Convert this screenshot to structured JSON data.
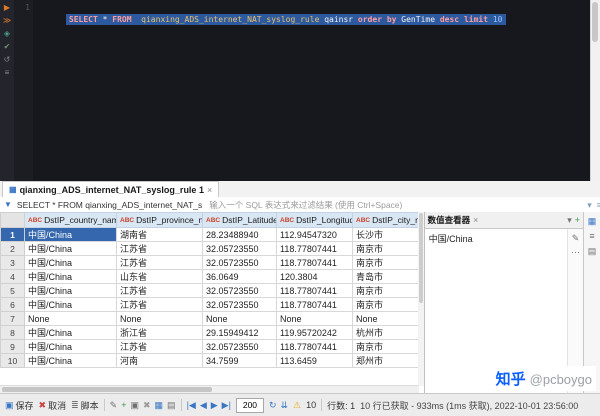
{
  "colors": {
    "selection_blue": "#2d5a9e",
    "accent_blue": "#3a76c4",
    "warning_yellow": "#e6a817",
    "brand_blue": "#0b5fff",
    "header_blue": "#d9e7f4",
    "cell_selected_blue": "#3467ad"
  },
  "editor": {
    "line_number": "1",
    "toolbar_icons": [
      {
        "name": "execute-statement-icon",
        "glyph": "▶",
        "color": "#d97a2b"
      },
      {
        "name": "execute-script-icon",
        "glyph": "≫",
        "color": "#d97a2b"
      },
      {
        "name": "explain-plan-icon",
        "glyph": "◈",
        "color": "#4a9e8f"
      },
      {
        "name": "commit-icon",
        "glyph": "✔",
        "color": "#6f8f6f"
      },
      {
        "name": "rollback-icon",
        "glyph": "↺",
        "color": "#8a8a96"
      },
      {
        "name": "editor-menu-icon",
        "glyph": "≡",
        "color": "#8a8a96"
      }
    ],
    "tokens": [
      {
        "type": "kw",
        "text": "SELECT"
      },
      {
        "type": "plain",
        "text": " * "
      },
      {
        "type": "kw",
        "text": "FROM"
      },
      {
        "type": "plain",
        "text": "  "
      },
      {
        "type": "table",
        "text": "qianxing_ADS_internet_NAT_syslog_rule"
      },
      {
        "type": "plain",
        "text": " qainsr "
      },
      {
        "type": "kw",
        "text": "order"
      },
      {
        "type": "plain",
        "text": " "
      },
      {
        "type": "kw",
        "text": "by"
      },
      {
        "type": "plain",
        "text": " GenTime "
      },
      {
        "type": "kw",
        "text": "desc"
      },
      {
        "type": "plain",
        "text": " "
      },
      {
        "type": "kw",
        "text": "limit"
      },
      {
        "type": "plain",
        "text": " "
      },
      {
        "type": "num",
        "text": "10"
      }
    ]
  },
  "tabbar": {
    "tab_icon_glyph": "▦",
    "tab_label": "qianxing_ADS_internet_NAT_syslog_rule 1",
    "tab_close_glyph": "×"
  },
  "filterbar": {
    "icon_glyph": "▼",
    "reference": "SELECT * FROM qianxing_ADS_internet_NAT_s",
    "placeholder": "输入一个 SQL 表达式来过滤结果 (使用 Ctrl+Space)",
    "right_icons": [
      {
        "name": "apply-filter-icon",
        "glyph": "▾",
        "color": "#8aa0b8"
      },
      {
        "name": "filter-settings-icon",
        "glyph": "≡",
        "color": "#8aa0b8"
      }
    ]
  },
  "grid": {
    "type_badge": "ABC",
    "columns": [
      "DstIP_country_name",
      "DstIP_province_name",
      "DstIP_Latitude",
      "DstIP_Longitude",
      "DstIP_city_name"
    ],
    "rows": [
      [
        "中国/China",
        "湖南省",
        "28.23488940",
        "112.94547320",
        "长沙市"
      ],
      [
        "中国/China",
        "江苏省",
        "32.05723550",
        "118.77807441",
        "南京市"
      ],
      [
        "中国/China",
        "江苏省",
        "32.05723550",
        "118.77807441",
        "南京市"
      ],
      [
        "中国/China",
        "山东省",
        "36.0649",
        "120.3804",
        "青岛市"
      ],
      [
        "中国/China",
        "江苏省",
        "32.05723550",
        "118.77807441",
        "南京市"
      ],
      [
        "中国/China",
        "江苏省",
        "32.05723550",
        "118.77807441",
        "南京市"
      ],
      [
        "None",
        "None",
        "None",
        "None",
        "None"
      ],
      [
        "中国/China",
        "浙江省",
        "29.15949412",
        "119.95720242",
        "杭州市"
      ],
      [
        "中国/China",
        "江苏省",
        "32.05723550",
        "118.77807441",
        "南京市"
      ],
      [
        "中国/China",
        "河南",
        "34.7599",
        "113.6459",
        "郑州市"
      ]
    ],
    "selected": {
      "row": 0,
      "col": 0
    }
  },
  "value_panel": {
    "title": "数值查看器",
    "close_glyph": "×",
    "value": "中国/China",
    "head_icons": [
      {
        "name": "panel-menu-icon",
        "glyph": "▾",
        "color": "#707070"
      },
      {
        "name": "panel-add-icon",
        "glyph": "+",
        "color": "#3c9b46"
      }
    ],
    "side_icons": [
      {
        "name": "edit-value-icon",
        "glyph": "✎",
        "color": "#707070"
      },
      {
        "name": "value-actions-icon",
        "glyph": "⋯",
        "color": "#707070"
      }
    ]
  },
  "right_strip_icons": [
    {
      "name": "grid-panel-icon",
      "glyph": "▦",
      "color": "#3a76c4"
    },
    {
      "name": "metadata-panel-icon",
      "glyph": "≡",
      "color": "#707070"
    },
    {
      "name": "value-panel-toggle-icon",
      "glyph": "▤",
      "color": "#707070"
    }
  ],
  "statusbar": {
    "save_label": "保存",
    "save_icon_glyph": "▣",
    "cancel_label": "取消",
    "cancel_icon_glyph": "✖",
    "script_label": "脚本",
    "script_icon_glyph": "≣",
    "edit_icons": [
      {
        "name": "edit-cell-icon",
        "glyph": "✎",
        "color": "#707070"
      },
      {
        "name": "add-row-icon",
        "glyph": "+",
        "color": "#3c9b46"
      },
      {
        "name": "duplicate-row-icon",
        "glyph": "▣",
        "color": "#707070"
      },
      {
        "name": "delete-row-icon",
        "glyph": "✖",
        "color": "#9a9a9a"
      },
      {
        "name": "grid-mode-icon",
        "glyph": "▦",
        "color": "#3a76c4"
      },
      {
        "name": "panels-icon",
        "glyph": "▤",
        "color": "#707070"
      }
    ],
    "nav_icons": [
      {
        "name": "first-row-icon",
        "glyph": "|◀",
        "color": "#3a76c4"
      },
      {
        "name": "previous-row-icon",
        "glyph": "◀",
        "color": "#3a76c4"
      },
      {
        "name": "next-row-icon",
        "glyph": "▶",
        "color": "#3a76c4"
      },
      {
        "name": "last-row-icon",
        "glyph": "▶|",
        "color": "#3a76c4"
      }
    ],
    "fetch_size": "200",
    "after_icons": [
      {
        "name": "fetch-next-page-icon",
        "glyph": "↻",
        "color": "#3a76c4"
      },
      {
        "name": "fetch-all-icon",
        "glyph": "⇊",
        "color": "#3a76c4"
      }
    ],
    "warning_icon_glyph": "⚠",
    "fetched_count": "10",
    "rows_label": "行数: 1",
    "status_text": "10 行已获取 - 933ms (1ms 获取), 2022-10-01 23:56:00"
  },
  "watermark": {
    "brand": "知乎",
    "handle": "@pcboygo"
  }
}
